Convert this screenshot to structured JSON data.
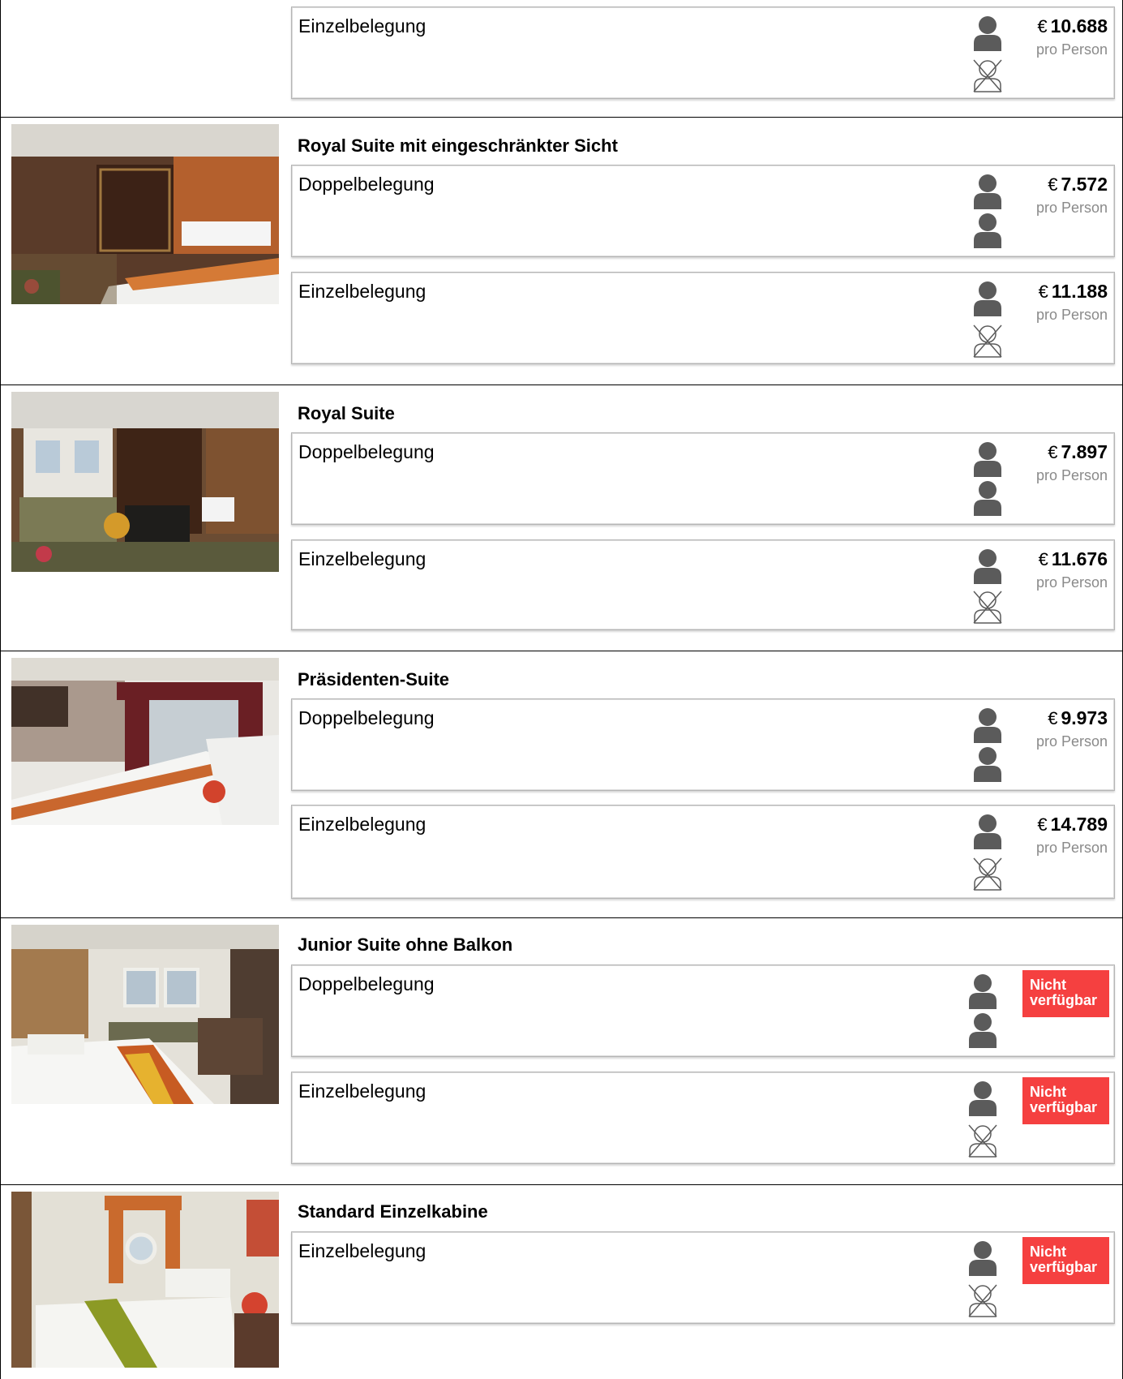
{
  "colors": {
    "unavailable": "#f54040",
    "person_icon": "#5b5b5b",
    "muted": "#8a8a8a"
  },
  "cabins": [
    {
      "title": "",
      "image": "cabin-photo-partial",
      "options": [
        {
          "label": "Einzelbelegung",
          "persons": "single",
          "currency": "€",
          "price": "10.688",
          "unit": "pro Person",
          "available": true
        }
      ]
    },
    {
      "title": "Royal Suite mit eingeschränkter Sicht",
      "image": "royal-suite-limited-view-photo",
      "options": [
        {
          "label": "Doppelbelegung",
          "persons": "double",
          "currency": "€",
          "price": "7.572",
          "unit": "pro Person",
          "available": true
        },
        {
          "label": "Einzelbelegung",
          "persons": "single",
          "currency": "€",
          "price": "11.188",
          "unit": "pro Person",
          "available": true
        }
      ]
    },
    {
      "title": "Royal Suite",
      "image": "royal-suite-photo",
      "options": [
        {
          "label": "Doppelbelegung",
          "persons": "double",
          "currency": "€",
          "price": "7.897",
          "unit": "pro Person",
          "available": true
        },
        {
          "label": "Einzelbelegung",
          "persons": "single",
          "currency": "€",
          "price": "11.676",
          "unit": "pro Person",
          "available": true
        }
      ]
    },
    {
      "title": "Präsidenten-Suite",
      "image": "presidential-suite-photo",
      "options": [
        {
          "label": "Doppelbelegung",
          "persons": "double",
          "currency": "€",
          "price": "9.973",
          "unit": "pro Person",
          "available": true
        },
        {
          "label": "Einzelbelegung",
          "persons": "single",
          "currency": "€",
          "price": "14.789",
          "unit": "pro Person",
          "available": true
        }
      ]
    },
    {
      "title": "Junior Suite ohne Balkon",
      "image": "junior-suite-photo",
      "options": [
        {
          "label": "Doppelbelegung",
          "persons": "double",
          "status": "Nicht verfügbar",
          "available": false
        },
        {
          "label": "Einzelbelegung",
          "persons": "single",
          "status": "Nicht verfügbar",
          "available": false
        }
      ]
    },
    {
      "title": "Standard Einzelkabine",
      "image": "standard-single-cabin-photo",
      "options": [
        {
          "label": "Einzelbelegung",
          "persons": "single",
          "status": "Nicht verfügbar",
          "available": false
        }
      ]
    }
  ]
}
